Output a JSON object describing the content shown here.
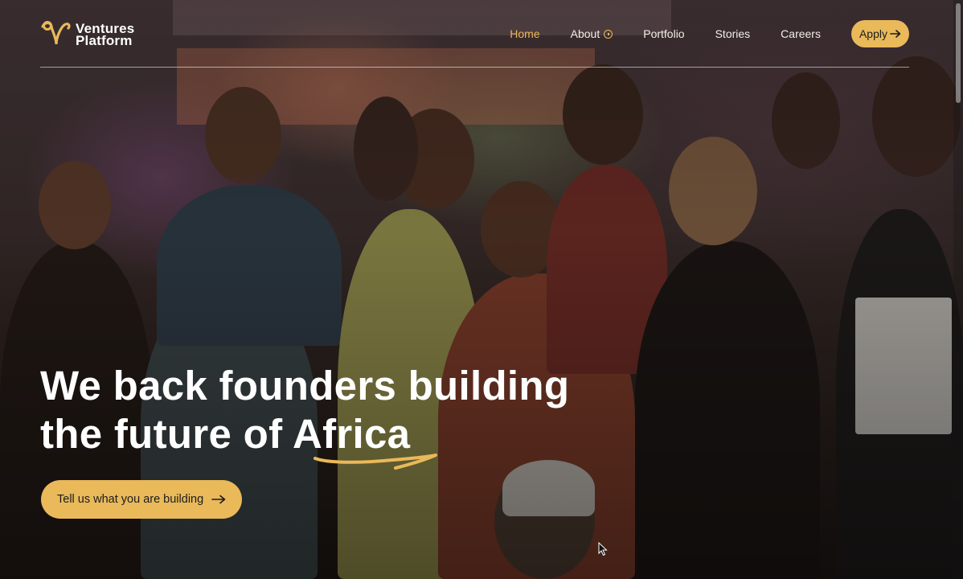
{
  "brand": {
    "name_line1": "Ventures",
    "name_line2": "Platform",
    "accent_color": "#e9b95a"
  },
  "nav": {
    "items": [
      {
        "label": "Home",
        "active": true
      },
      {
        "label": "About",
        "has_icon": true,
        "icon": "info-icon"
      },
      {
        "label": "Portfolio"
      },
      {
        "label": "Stories"
      },
      {
        "label": "Careers"
      }
    ],
    "apply_label": "Apply",
    "apply_icon": "arrow-right-icon"
  },
  "hero": {
    "title_part1": "We back founders building",
    "title_part2_prefix": "the future of ",
    "title_highlight": "Africa",
    "cta_label": "Tell us what you are building",
    "cta_icon": "arrow-right-icon"
  }
}
